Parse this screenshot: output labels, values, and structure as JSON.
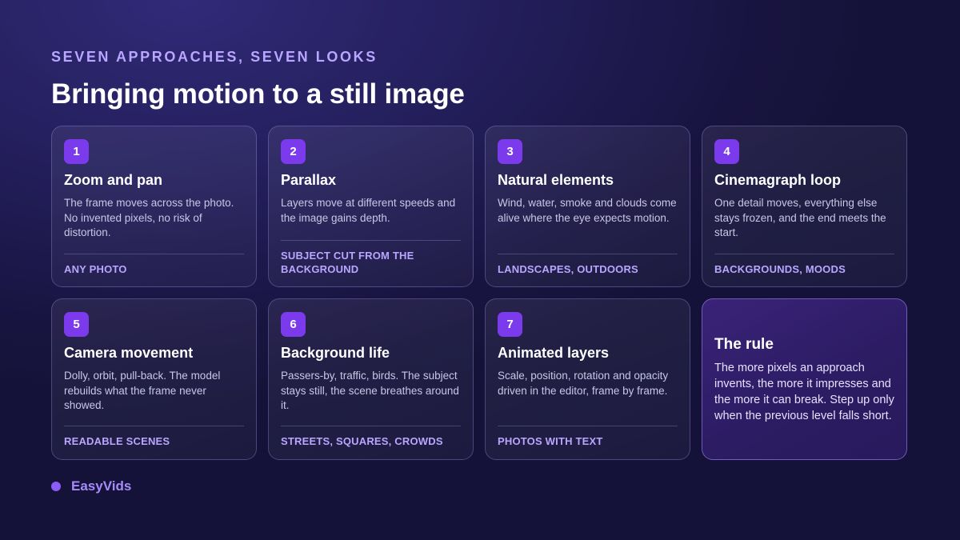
{
  "header": {
    "kicker": "SEVEN APPROACHES, SEVEN LOOKS",
    "title": "Bringing motion to a still image"
  },
  "cards": [
    {
      "number": "1",
      "title": "Zoom and pan",
      "description": "The frame moves across the photo. No invented pixels, no risk of distortion.",
      "tag": "ANY PHOTO"
    },
    {
      "number": "2",
      "title": "Parallax",
      "description": "Layers move at different speeds and the image gains depth.",
      "tag": "SUBJECT CUT FROM THE BACKGROUND"
    },
    {
      "number": "3",
      "title": "Natural elements",
      "description": "Wind, water, smoke and clouds come alive where the eye expects motion.",
      "tag": "LANDSCAPES, OUTDOORS"
    },
    {
      "number": "4",
      "title": "Cinemagraph loop",
      "description": "One detail moves, everything else stays frozen, and the end meets the start.",
      "tag": "BACKGROUNDS, MOODS"
    },
    {
      "number": "5",
      "title": "Camera movement",
      "description": "Dolly, orbit, pull-back. The model rebuilds what the frame never showed.",
      "tag": "READABLE SCENES"
    },
    {
      "number": "6",
      "title": "Background life",
      "description": "Passers-by, traffic, birds. The subject stays still, the scene breathes around it.",
      "tag": "STREETS, SQUARES, CROWDS"
    },
    {
      "number": "7",
      "title": "Animated layers",
      "description": "Scale, position, rotation and opacity driven in the editor, frame by frame.",
      "tag": "PHOTOS WITH TEXT"
    }
  ],
  "rule": {
    "title": "The rule",
    "text": "The more pixels an approach invents, the more it impresses and the more it can break. Step up only when the previous level falls short."
  },
  "brand": {
    "name": "EasyVids"
  },
  "colors": {
    "accent": "#7c3aed",
    "accent_light": "#b9a6ff",
    "brand": "#a78bfa",
    "background": "#1c1848"
  }
}
